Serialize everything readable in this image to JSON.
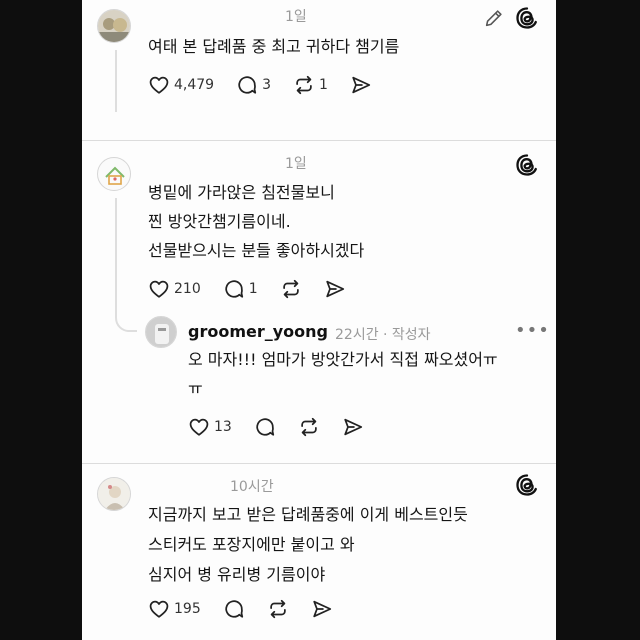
{
  "posts": [
    {
      "time": "1일",
      "lines": [
        "여태 본 답례품 중 최고 귀하다 챔기름"
      ],
      "likes": "4,479",
      "replies": "3",
      "reposts": "1"
    },
    {
      "time": "1일",
      "lines": [
        "병밑에 가라앉은 침전물보니",
        " 찐 방앗간챔기름이네.",
        "선물받으시는 분들 좋아하시겠다"
      ],
      "likes": "210",
      "replies": "1"
    },
    {
      "username": "groomer_yoong",
      "meta": "22시간 · 작성자",
      "more": "•••",
      "lines": [
        "오 마자!!! 엄마가 방앗간가서 직접 짜오셨어ㅠ",
        "ㅠ"
      ],
      "likes": "13"
    },
    {
      "time": "10시간",
      "lines": [
        "지금까지 보고 받은 답례품중에 이게 베스트인듯",
        "스티커도 포장지에만 붙이고 와",
        "심지어 병 유리병 기름이야"
      ],
      "likes": "195"
    }
  ],
  "icons": {
    "like": "heart-icon",
    "reply": "comment-icon",
    "repost": "repost-icon",
    "share": "send-icon",
    "edit": "pencil-icon",
    "brand": "threads-logo-icon"
  },
  "colors": {
    "text": "#151515",
    "muted": "#9a9a9a",
    "divider": "#dcdcdc",
    "background": "#0e0e0e"
  }
}
